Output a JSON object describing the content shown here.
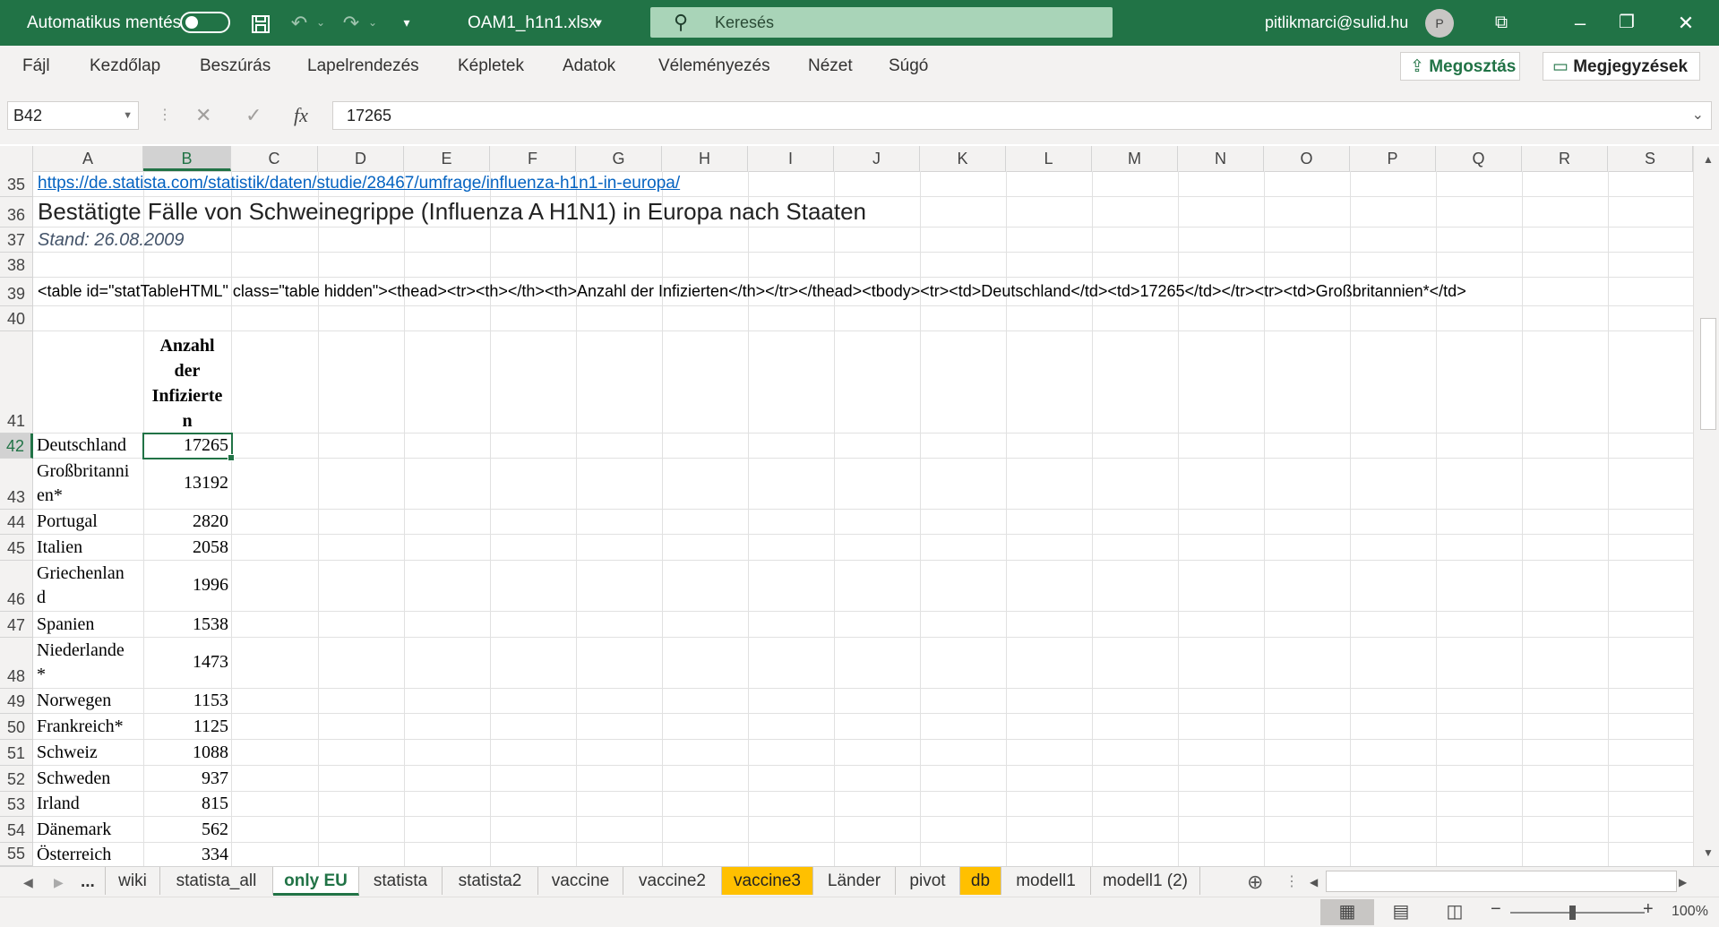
{
  "titlebar": {
    "autosave_label": "Automatikus mentés",
    "filename": "OAM1_h1n1.xlsx",
    "search_placeholder": "Keresés",
    "user_email": "pitlikmarci@sulid.hu",
    "avatar_initial": "P"
  },
  "menu": [
    "Fájl",
    "Kezdőlap",
    "Beszúrás",
    "Lapelrendezés",
    "Képletek",
    "Adatok",
    "Véleményezés",
    "Nézet",
    "Súgó"
  ],
  "ribbon_buttons": {
    "share": "Megosztás",
    "comments": "Megjegyzések"
  },
  "formula_bar": {
    "name_box": "B42",
    "fx_label": "fx",
    "value": "17265"
  },
  "columns": [
    "A",
    "B",
    "C",
    "D",
    "E",
    "F",
    "G",
    "H",
    "I",
    "J",
    "K",
    "L",
    "M",
    "N",
    "O",
    "P",
    "Q",
    "R",
    "S"
  ],
  "rows": {
    "r35": {
      "num": "35",
      "a": "https://de.statista.com/statistik/daten/studie/28467/umfrage/influenza-h1n1-in-europa/"
    },
    "r36": {
      "num": "36",
      "a": "Bestätigte Fälle von Schweinegrippe (Influenza A H1N1) in Europa nach Staaten"
    },
    "r37": {
      "num": "37",
      "a": "Stand: 26.08.2009"
    },
    "r38": {
      "num": "38"
    },
    "r39": {
      "num": "39",
      "a": "<table id=\"statTableHTML\" class=\"table hidden\"><thead><tr><th></th><th>Anzahl der Infizierten</th></tr></thead><tbody><tr><td>Deutschland</td><td>17265</td></tr><tr><td>Großbritannien*</td>"
    },
    "r40": {
      "num": "40"
    },
    "r41": {
      "num": "41",
      "b_lines": [
        "Anzahl",
        "der",
        "Infizierte",
        "n"
      ]
    }
  },
  "data_rows": [
    {
      "num": "42",
      "country_lines": [
        "Deutschland"
      ],
      "value": "17265"
    },
    {
      "num": "43",
      "country_lines": [
        "Großbritanni",
        "en*"
      ],
      "value": "13192"
    },
    {
      "num": "44",
      "country_lines": [
        "Portugal"
      ],
      "value": "2820"
    },
    {
      "num": "45",
      "country_lines": [
        "Italien"
      ],
      "value": "2058"
    },
    {
      "num": "46",
      "country_lines": [
        "Griechenlan",
        "d"
      ],
      "value": "1996"
    },
    {
      "num": "47",
      "country_lines": [
        "Spanien"
      ],
      "value": "1538"
    },
    {
      "num": "48",
      "country_lines": [
        "Niederlande",
        "*"
      ],
      "value": "1473"
    },
    {
      "num": "49",
      "country_lines": [
        "Norwegen"
      ],
      "value": "1153"
    },
    {
      "num": "50",
      "country_lines": [
        "Frankreich*"
      ],
      "value": "1125"
    },
    {
      "num": "51",
      "country_lines": [
        "Schweiz"
      ],
      "value": "1088"
    },
    {
      "num": "52",
      "country_lines": [
        "Schweden"
      ],
      "value": "937"
    },
    {
      "num": "53",
      "country_lines": [
        "Irland"
      ],
      "value": "815"
    },
    {
      "num": "54",
      "country_lines": [
        "Dänemark"
      ],
      "value": "562"
    },
    {
      "num": "55",
      "country_lines": [
        "Österreich"
      ],
      "value": "334"
    }
  ],
  "sheet_tabs": [
    {
      "label": "wiki",
      "style": "normal"
    },
    {
      "label": "statista_all",
      "style": "normal"
    },
    {
      "label": "only EU",
      "style": "active"
    },
    {
      "label": "statista",
      "style": "normal"
    },
    {
      "label": "statista2",
      "style": "normal"
    },
    {
      "label": "vaccine",
      "style": "normal"
    },
    {
      "label": "vaccine2",
      "style": "normal"
    },
    {
      "label": "vaccine3",
      "style": "orange"
    },
    {
      "label": "Länder",
      "style": "normal"
    },
    {
      "label": "pivot",
      "style": "normal"
    },
    {
      "label": "db",
      "style": "orange"
    },
    {
      "label": "modell1",
      "style": "normal"
    },
    {
      "label": "modell1 (2)",
      "style": "normal"
    }
  ],
  "tab_nav": {
    "more": "..."
  },
  "status": {
    "zoom": "100%"
  },
  "colors": {
    "excel_green": "#217346",
    "tab_orange": "#ffc000",
    "link_blue": "#0563c1"
  }
}
